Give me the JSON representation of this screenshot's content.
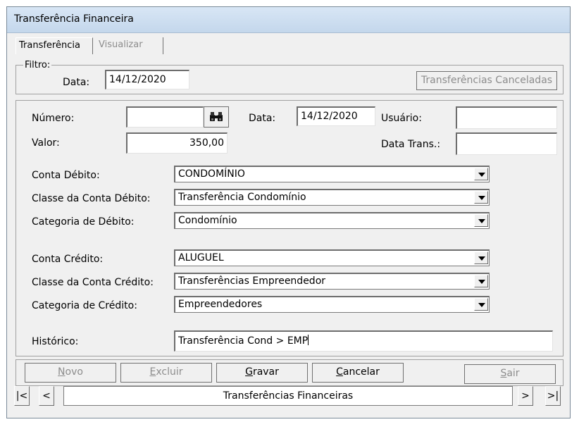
{
  "window": {
    "title": "Transferência Financeira"
  },
  "tabs": [
    {
      "label": "Transferência",
      "active": true
    },
    {
      "label": "Visualizar",
      "active": false
    }
  ],
  "filter": {
    "legend": "Filtro:",
    "date_label": "Data:",
    "date_value": "14/12/2020",
    "canceled_button": "Transferências Canceladas"
  },
  "form": {
    "numero_label": "Número:",
    "numero_value": "",
    "data_label": "Data:",
    "data_value": "14/12/2020",
    "usuario_label": "Usuário:",
    "usuario_value": "",
    "valor_label": "Valor:",
    "valor_value": "350,00",
    "data_trans_label": "Data Trans.:",
    "data_trans_value": "",
    "conta_debito_label": "Conta Débito:",
    "conta_debito_value": "CONDOMÍNIO",
    "classe_debito_label": "Classe da Conta Débito:",
    "classe_debito_value": "Transferência Condomínio",
    "categoria_debito_label": "Categoria de Débito:",
    "categoria_debito_value": "Condomínio",
    "conta_credito_label": "Conta Crédito:",
    "conta_credito_value": "ALUGUEL",
    "classe_credito_label": "Classe da Conta Crédito:",
    "classe_credito_value": "Transferências Empreendedor",
    "categoria_credito_label": "Categoria de Crédito:",
    "categoria_credito_value": "Empreendedores",
    "historico_label": "Histórico:",
    "historico_value": "Transferência Cond > EMP"
  },
  "buttons": {
    "novo": {
      "accel": "N",
      "rest": "ovo"
    },
    "excluir": {
      "accel": "E",
      "rest": "xcluir"
    },
    "gravar": {
      "accel": "G",
      "rest": "ravar"
    },
    "cancelar": {
      "accel": "C",
      "rest": "ancelar"
    },
    "sair": {
      "accel": "S",
      "rest": "air"
    }
  },
  "navigator": {
    "first": "|<",
    "prev": "<",
    "label": "Transferências Financeiras",
    "next": ">",
    "last": ">|"
  },
  "icons": {
    "search": "binoculars-icon",
    "dropdown": "chevron-down-icon"
  }
}
